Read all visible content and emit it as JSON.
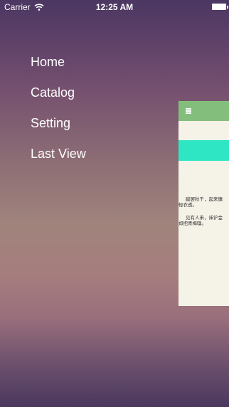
{
  "status_bar": {
    "carrier": "Carrier",
    "time": "12:25 AM",
    "icons": [
      "wifi-icon",
      "battery-icon"
    ]
  },
  "menu": {
    "items": [
      {
        "label": "Home"
      },
      {
        "label": "Catalog"
      },
      {
        "label": "Setting"
      },
      {
        "label": "Last View"
      }
    ]
  },
  "content_panel": {
    "header_icon": "hamburger-icon",
    "colors": {
      "header": "#83be7c",
      "accent_bar": "#2fe6c4",
      "page": "#f5f2e8"
    },
    "paragraphs": [
      {
        "line1": "蹴罢秋千，起来慵",
        "line2": "轻衣透。"
      },
      {
        "line1": "见有人来，袜铲金",
        "line2": "却把青梅嗅。"
      }
    ]
  }
}
